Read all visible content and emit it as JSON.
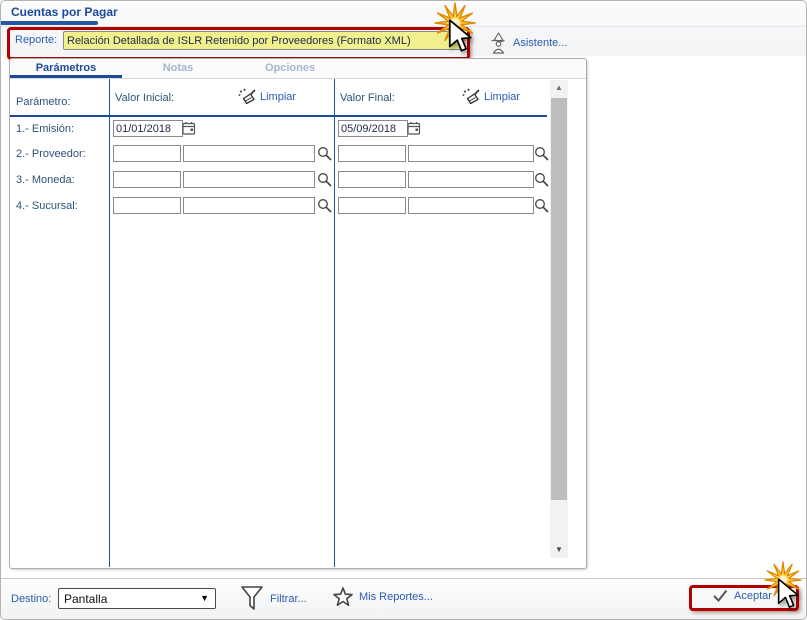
{
  "window": {
    "title": "Cuentas por Pagar"
  },
  "report_bar": {
    "label": "Reporte:",
    "value": "Relación Detallada de ISLR Retenido por Proveedores (Formato XML)",
    "assistant_label": "Asistente..."
  },
  "tabs": [
    {
      "label": "Parámetros",
      "active": true
    },
    {
      "label": "Notas",
      "active": false
    },
    {
      "label": "Opciones",
      "active": false
    }
  ],
  "parameters": {
    "header": {
      "param_label": "Parámetro:",
      "initial_label": "Valor Inicial:",
      "final_label": "Valor Final:",
      "clear_label": "Limpiar"
    },
    "rows": [
      {
        "label": "1.- Emisión:",
        "type": "date",
        "initial": "01/01/2018",
        "final": "05/09/2018"
      },
      {
        "label": "2.- Proveedor:",
        "type": "lookup",
        "initial_code": "",
        "initial_name": "",
        "final_code": "",
        "final_name": ""
      },
      {
        "label": "3.- Moneda:",
        "type": "lookup",
        "initial_code": "",
        "initial_name": "",
        "final_code": "",
        "final_name": ""
      },
      {
        "label": "4.- Sucursal:",
        "type": "lookup",
        "initial_code": "",
        "initial_name": "",
        "final_code": "",
        "final_name": ""
      }
    ]
  },
  "footer": {
    "destination_label": "Destino:",
    "destination_value": "Pantalla",
    "filter_label": "Filtrar...",
    "my_reports_label": "Mis Reportes...",
    "accept_label": "Aceptar"
  },
  "icons": {
    "dropdown_caret": "▼",
    "scroll_up": "▲",
    "scroll_down": "▼"
  },
  "colors": {
    "accent_blue": "#1b4a9b",
    "link_blue": "#2a5db0",
    "highlight_yellow": "#f0f08c",
    "annotation_red": "#b00000",
    "separator_blue": "#23539e"
  }
}
